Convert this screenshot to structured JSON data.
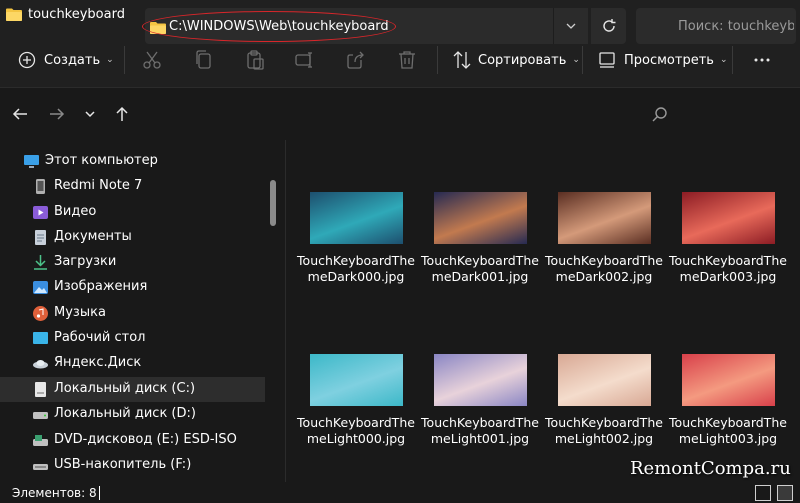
{
  "window": {
    "title": "touchkeyboard",
    "icons": [
      "folder-icon",
      "minimize-icon",
      "maximize-icon",
      "close-icon"
    ]
  },
  "toolbar": {
    "new_label": "Создать",
    "sort_label": "Сортировать",
    "view_label": "Просмотреть",
    "icons": [
      "plus-circle-icon",
      "cut-icon",
      "copy-icon",
      "paste-icon",
      "rename-icon",
      "share-icon",
      "delete-icon",
      "sort-icon",
      "view-icon",
      "more-icon"
    ]
  },
  "address": {
    "path": "C:\\WINDOWS\\Web\\touchkeyboard",
    "search_placeholder": "Поиск: touchkeyb...",
    "highlight_color": "#d7262a"
  },
  "sidebar": {
    "items": [
      {
        "label": "Этот компьютер",
        "icon": "computer-icon"
      },
      {
        "label": "Redmi Note 7",
        "icon": "phone-icon"
      },
      {
        "label": "Видео",
        "icon": "video-icon"
      },
      {
        "label": "Документы",
        "icon": "documents-icon"
      },
      {
        "label": "Загрузки",
        "icon": "download-icon"
      },
      {
        "label": "Изображения",
        "icon": "pictures-icon"
      },
      {
        "label": "Музыка",
        "icon": "music-icon"
      },
      {
        "label": "Рабочий стол",
        "icon": "desktop-icon"
      },
      {
        "label": "Яндекс.Диск",
        "icon": "yandex-disk-icon"
      },
      {
        "label": "Локальный диск (C:)",
        "icon": "drive-icon",
        "selected": true
      },
      {
        "label": "Локальный диск (D:)",
        "icon": "drive-icon"
      },
      {
        "label": "DVD-дисковод (E:) ESD-ISO",
        "icon": "dvd-icon"
      },
      {
        "label": "USB-накопитель (F:)",
        "icon": "usb-icon"
      }
    ]
  },
  "files": [
    {
      "name": "TouchKeyboardThemeDark000.jpg",
      "c1": "#1d4f6e",
      "c2": "#2fa9b8"
    },
    {
      "name": "TouchKeyboardThemeDark001.jpg",
      "c1": "#262a52",
      "c2": "#c27a4f"
    },
    {
      "name": "TouchKeyboardThemeDark002.jpg",
      "c1": "#5a2e22",
      "c2": "#d49a7a"
    },
    {
      "name": "TouchKeyboardThemeDark003.jpg",
      "c1": "#8c1c24",
      "c2": "#e86a5a"
    },
    {
      "name": "TouchKeyboardThemeLight000.jpg",
      "c1": "#3cb8c8",
      "c2": "#7fd0e0"
    },
    {
      "name": "TouchKeyboardThemeLight001.jpg",
      "c1": "#8a86c4",
      "c2": "#e8d2da"
    },
    {
      "name": "TouchKeyboardThemeLight002.jpg",
      "c1": "#d8a894",
      "c2": "#f4dccc"
    },
    {
      "name": "TouchKeyboardThemeLight003.jpg",
      "c1": "#d8404a",
      "c2": "#f49a80"
    }
  ],
  "status": {
    "items_count": "Элементов: 8"
  },
  "watermark": "RemontCompa.ru"
}
